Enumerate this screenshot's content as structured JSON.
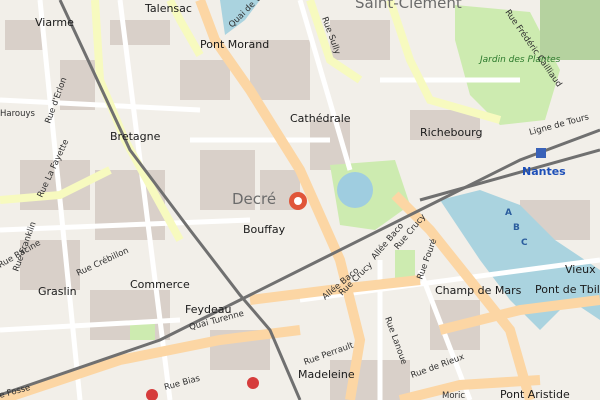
{
  "map": {
    "places": {
      "saint_clement": "Saint-Clément",
      "talensac": "Talensac",
      "viarme": "Viarme",
      "pont_morand": "Pont Morand",
      "bretagne": "Bretagne",
      "cathedrale": "Cathédrale",
      "richebourg": "Richebourg",
      "decre": "Decré",
      "bouffay": "Bouffay",
      "graslin": "Graslin",
      "commerce": "Commerce",
      "feydeau": "Feydeau",
      "madeleine": "Madeleine",
      "champ_de_mars": "Champ de Mars",
      "pont_de_tbilissi": "Pont de Tbilissi",
      "vieux_m": "Vieux M",
      "pont_aristide": "Pont Aristide",
      "nantes": "Nantes",
      "jardin_des_plantes": "Jardin des Plantes"
    },
    "streets": {
      "quai_henri": "Quai de Ve…",
      "rue_sully": "Rue Sully",
      "rue_frederic_cailliaud": "Rue Frédéric Cailliaud",
      "rue_derlon": "Rue d'Erlon",
      "rue_harouys": "Harouys",
      "rue_la_fayette": "Rue La Fayette",
      "rue_franklin": "Rue Franklin",
      "rue_racine": "Rue Racine",
      "rue_crebillon": "Rue Crébillon",
      "quai_turenne": "Quai Turenne",
      "allee_baco": "Allée Baco",
      "rue_crucy": "Rue Crucy",
      "rue_fouré": "Rue Fouré",
      "rue_lanoue": "Rue Lanoue",
      "rue_perrault": "Rue Perrault",
      "rue_de_rieux": "Rue de Rieux",
      "rue_bias": "Rue Bias",
      "rue_fosse": "e Fosse",
      "ligne_de_tours": "Ligne de Tours",
      "quai_moric": "Moric"
    },
    "water_letters": [
      "A",
      "B",
      "C"
    ],
    "colors": {
      "background": "#f2efe9",
      "building": "#d9d0c9",
      "primary_road": "#fcd6a4",
      "secondary_road": "#f7fabf",
      "minor_road": "#ffffff",
      "railway": "#707070",
      "water": "#aad3df",
      "park": "#cdebb0",
      "marker": "#e0563a"
    }
  }
}
